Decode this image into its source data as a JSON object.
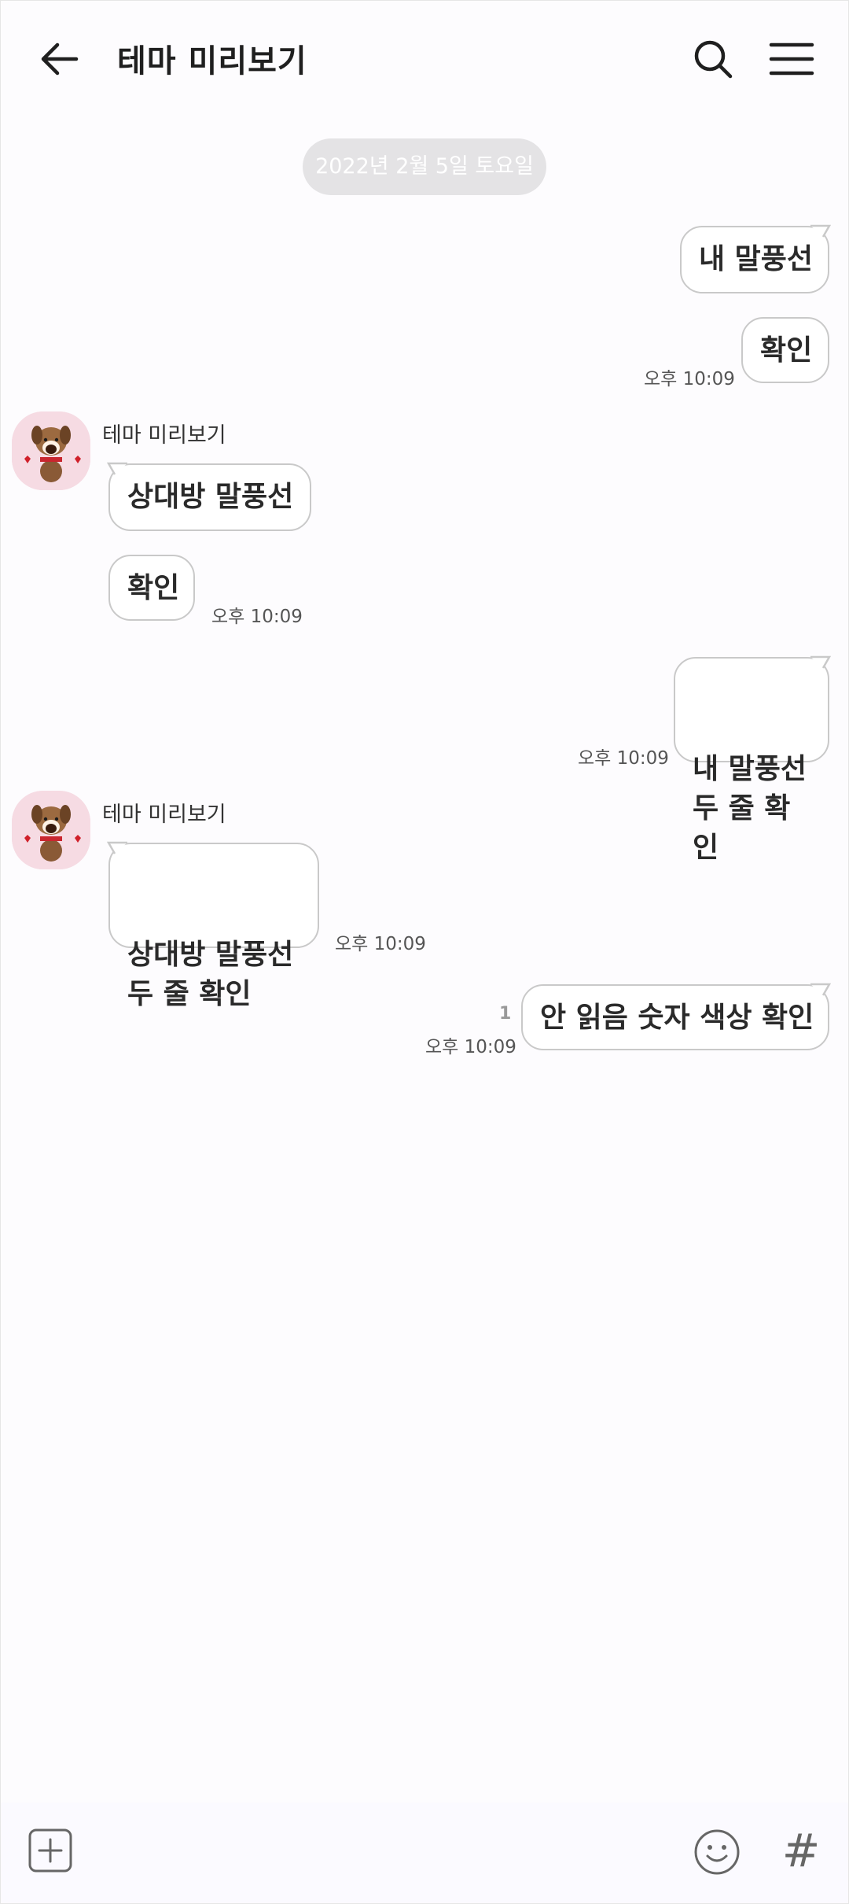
{
  "header": {
    "title": "테마 미리보기",
    "back_icon": "arrow-left-icon",
    "search_icon": "search-icon",
    "menu_icon": "hamburger-menu-icon"
  },
  "date_divider": "2022년 2월 5일 토요일",
  "messages": [
    {
      "side": "me",
      "text": "내 말풍선"
    },
    {
      "side": "me",
      "text": "확인",
      "time": "오후 10:09"
    },
    {
      "side": "other",
      "sender": "테마 미리보기",
      "text": "상대방 말풍선"
    },
    {
      "side": "other",
      "text": "확인",
      "time": "오후 10:09"
    },
    {
      "side": "me",
      "text": "내 말풍선\n두 줄 확인",
      "time": "오후 10:09"
    },
    {
      "side": "other",
      "sender": "테마 미리보기",
      "text": "상대방 말풍선\n두 줄 확인",
      "time": "오후 10:09"
    },
    {
      "side": "me",
      "text": "안 읽음 숫자 색상 확인",
      "time": "오후 10:09",
      "unread": "1"
    }
  ],
  "input_bar": {
    "plus_icon": "plus-square-icon",
    "emoji_icon": "smiley-icon",
    "hash_label": "#"
  },
  "colors": {
    "background": "#fdfcfe",
    "bubble_border": "#c9c9c9",
    "date_pill": "#e4e3e5",
    "avatar_bg": "#f6dbe3"
  }
}
